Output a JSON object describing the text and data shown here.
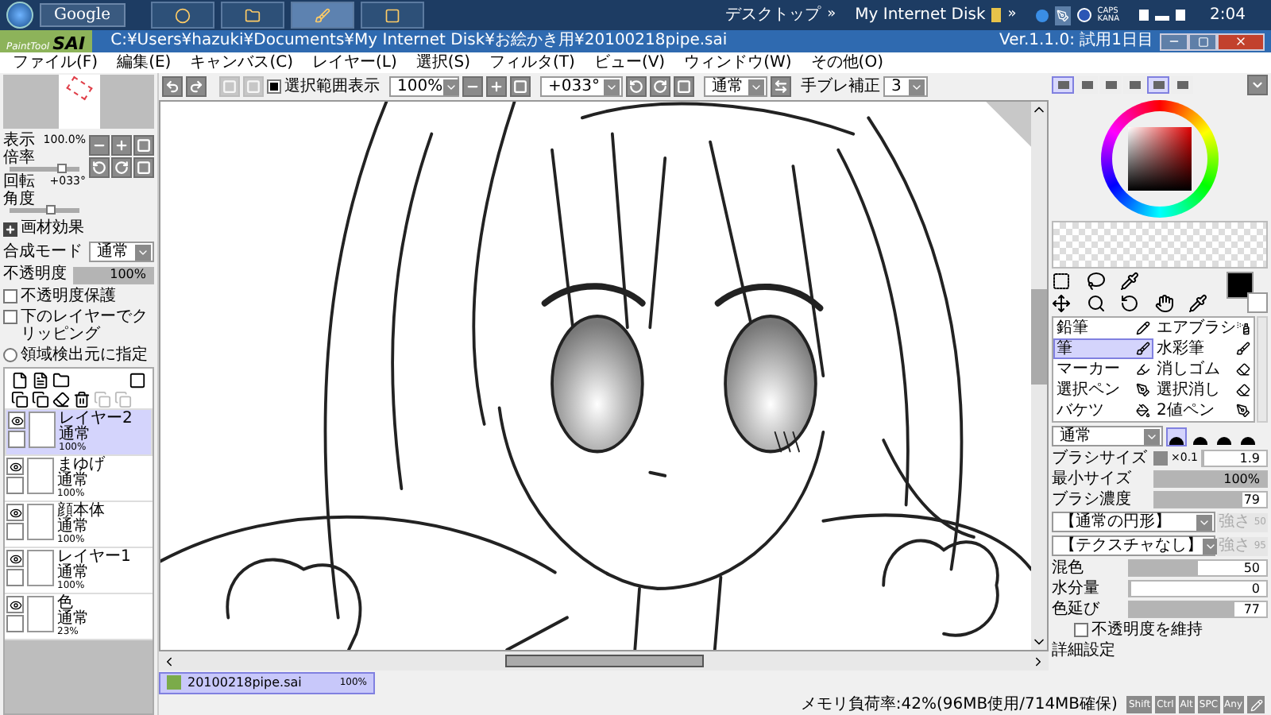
{
  "taskbar": {
    "search_label": "Google",
    "apps": [
      {
        "selected": false
      },
      {
        "selected": false
      },
      {
        "selected": true
      },
      {
        "selected": false
      }
    ],
    "desktop_label": "デスクトップ",
    "desktop_more": "»",
    "disk_label": "My Internet Disk",
    "disk_more": "»",
    "caps": "CAPS",
    "kana": "KANA",
    "clock": "2:04"
  },
  "window": {
    "logo_small": "PaintTool",
    "logo": "SAI",
    "path": "C:¥Users¥hazuki¥Documents¥My Internet Disk¥お絵かき用¥20100218pipe.sai",
    "version": "Ver.1.1.0: 試用1日目"
  },
  "menu": [
    "ファイル(F)",
    "編集(E)",
    "キャンバス(C)",
    "レイヤー(L)",
    "選択(S)",
    "フィルタ(T)",
    "ビュー(V)",
    "ウィンドウ(W)",
    "その他(O)"
  ],
  "navigator": {
    "zoom": {
      "label": "表示倍率",
      "value": "100.0%",
      "level": 0.75
    },
    "angle": {
      "label": "回転角度",
      "value": "+033°",
      "level": 0.6
    }
  },
  "layer_props": {
    "effects": "画材効果",
    "blend_label": "合成モード",
    "blend": "通常",
    "opacity": {
      "label": "不透明度",
      "reading": "100%",
      "level": 1
    },
    "options": [
      {
        "kind": "checkbox",
        "label": "不透明度保護",
        "checked": false
      },
      {
        "kind": "checkbox",
        "label": "下のレイヤーでクリッピング",
        "checked": false
      },
      {
        "kind": "radio",
        "label": "領域検出元に指定",
        "checked": false
      }
    ]
  },
  "layers": [
    {
      "name": "レイヤー2",
      "mode": "通常",
      "opacity": "100%",
      "visible": true,
      "selected": true
    },
    {
      "name": "まゆげ",
      "mode": "通常",
      "opacity": "100%",
      "visible": true,
      "selected": false
    },
    {
      "name": "顔本体",
      "mode": "通常",
      "opacity": "100%",
      "visible": true,
      "selected": false
    },
    {
      "name": "レイヤー1",
      "mode": "通常",
      "opacity": "100%",
      "visible": true,
      "selected": false
    },
    {
      "name": "色",
      "mode": "通常",
      "opacity": "23%",
      "visible": true,
      "selected": false
    }
  ],
  "toolbar": {
    "selection_label": "選択範囲表示",
    "selection_checked": true,
    "zoom": "100%",
    "angle": "+033°",
    "blend": "通常",
    "stabilizer_label": "手ブレ補正",
    "stabilizer": "3"
  },
  "color_modes": [
    {
      "selected": true
    },
    {
      "selected": false
    },
    {
      "selected": false
    },
    {
      "selected": false
    },
    {
      "selected": true
    },
    {
      "selected": false
    }
  ],
  "document_tab": {
    "name": "20100218pipe.sai",
    "zoom": "100%",
    "selected": true
  },
  "brushes": [
    {
      "label": "鉛筆",
      "selected": false
    },
    {
      "label": "エアブラシ",
      "selected": false
    },
    {
      "label": "筆",
      "selected": true
    },
    {
      "label": "水彩筆",
      "selected": false
    },
    {
      "label": "マーカー",
      "selected": false
    },
    {
      "label": "消しゴム",
      "selected": false
    },
    {
      "label": "選択ペン",
      "selected": false
    },
    {
      "label": "選択消し",
      "selected": false
    },
    {
      "label": "バケツ",
      "selected": false
    },
    {
      "label": "2値ペン",
      "selected": false
    }
  ],
  "brush_settings": {
    "blend": "通常",
    "shapes": [
      {
        "selected": true
      },
      {
        "selected": false
      },
      {
        "selected": false
      },
      {
        "selected": false
      }
    ],
    "sliders": [
      {
        "label": "ブラシサイズ",
        "multiplier": "×0.1",
        "reading": "1.9",
        "level": 0.02
      },
      {
        "label": "最小サイズ",
        "reading": "100%",
        "level": 1
      },
      {
        "label": "ブラシ濃度",
        "reading": "79",
        "level": 0.79
      }
    ],
    "textures": [
      {
        "value": "【通常の円形】",
        "strength_label": "強さ",
        "strength": "50",
        "disabled": true
      },
      {
        "value": "【テクスチャなし】",
        "strength_label": "強さ",
        "strength": "95",
        "disabled": true
      }
    ],
    "mix_sliders": [
      {
        "label": "混色",
        "reading": "50",
        "level": 0.5
      },
      {
        "label": "水分量",
        "reading": "0",
        "level": 0
      },
      {
        "label": "色延び",
        "reading": "77",
        "level": 0.77
      }
    ],
    "keep_opacity": {
      "label": "不透明度を維持",
      "checked": false
    },
    "details": "詳細設定"
  },
  "status_bar": {
    "memory": "メモリ負荷率:42%(96MB使用/714MB確保)",
    "keys": [
      "Shift",
      "Ctrl",
      "Alt",
      "SPC",
      "Any"
    ]
  }
}
